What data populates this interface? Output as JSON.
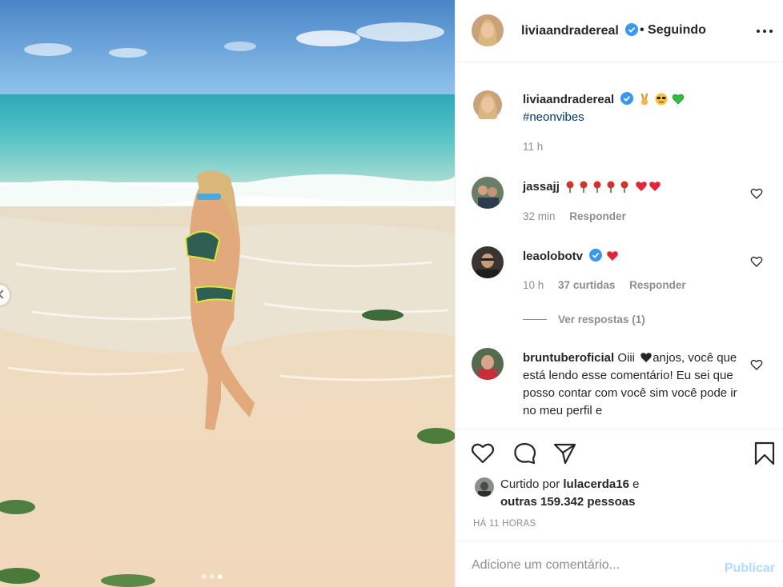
{
  "post": {
    "username": "liviaandradereal",
    "follow_status": "• Seguindo",
    "caption_hashtag": "#neonvibes",
    "caption_time": "11 h",
    "carousel": {
      "slides": 3,
      "active": 3
    }
  },
  "comments": [
    {
      "username": "jassajj",
      "time": "32 min",
      "reply": "Responder"
    },
    {
      "username": "leaolobotv",
      "time": "10 h",
      "likes": "37 curtidas",
      "reply": "Responder",
      "view_replies": "Ver respostas (1)"
    },
    {
      "username": "bruntuberoficial",
      "text_start": "Oiii",
      "text_rest": "anjos, você que está lendo esse comentário! Eu sei que posso contar com você sim você pode ir no meu perfil e"
    }
  ],
  "actions": {
    "liked_prefix": "Curtido por",
    "liked_user": "lulacerda16",
    "liked_and": "e",
    "liked_others": "outras 159.342 pessoas",
    "timestamp": "HÁ 11 HORAS"
  },
  "add_comment": {
    "placeholder": "Adicione um comentário...",
    "publish": "Publicar"
  },
  "colors": {
    "verified": "#3897f0",
    "publish_disabled": "#b3dbff",
    "link": "#00376b"
  }
}
